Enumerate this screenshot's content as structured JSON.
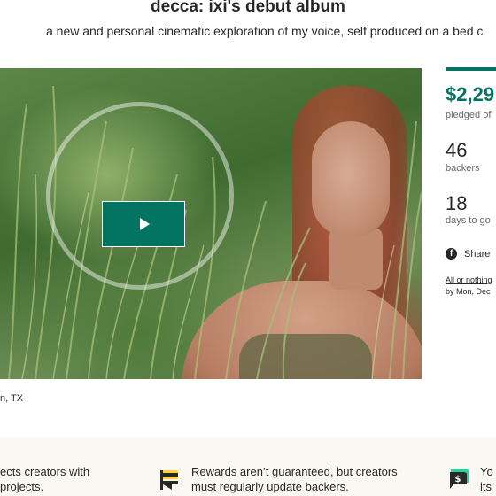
{
  "project": {
    "title": "decca: ixi's debut album",
    "subtitle": "a new and personal cinematic exploration of my voice, self produced on a bed c"
  },
  "video": {
    "play_icon": "play-icon"
  },
  "location": {
    "text": "n, TX"
  },
  "stats": {
    "accent_color": "#037362",
    "pledged_amount": "$2,29",
    "pledged_label": "pledged of",
    "backers_count": "46",
    "backers_label": "backers",
    "days_count": "18",
    "days_label": "days to go"
  },
  "share": {
    "icon": "facebook-icon",
    "label": "Share"
  },
  "funding": {
    "link_label": "All or nothing",
    "detail": "by Mon, Dec"
  },
  "footer": {
    "col1": {
      "line1": "ects creators with",
      "line2": "projects."
    },
    "col2": {
      "icon": "flag-icon",
      "line1": "Rewards aren’t guaranteed, but creators",
      "line2": "must regularly update backers."
    },
    "col3": {
      "icon": "money-chat-icon",
      "line1": "Yo",
      "line2": "its"
    }
  }
}
